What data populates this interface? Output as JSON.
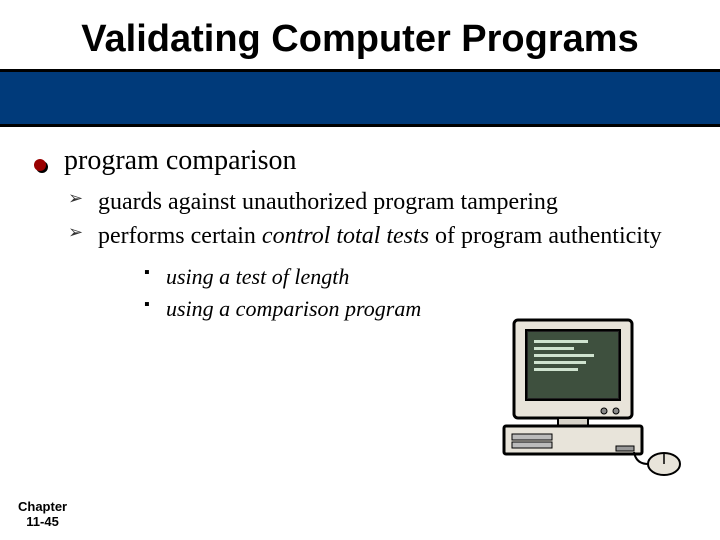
{
  "title": "Validating Computer Programs",
  "bullets": [
    {
      "text": "program comparison",
      "sub": [
        {
          "text": "guards against unauthorized program tampering"
        },
        {
          "pre": "performs certain",
          "em": "control total tests",
          "post": "of program authenticity",
          "sub": [
            "using a test of length",
            "using a comparison program"
          ]
        }
      ]
    }
  ],
  "footer": {
    "chapter": "Chapter",
    "page": "11-45"
  }
}
